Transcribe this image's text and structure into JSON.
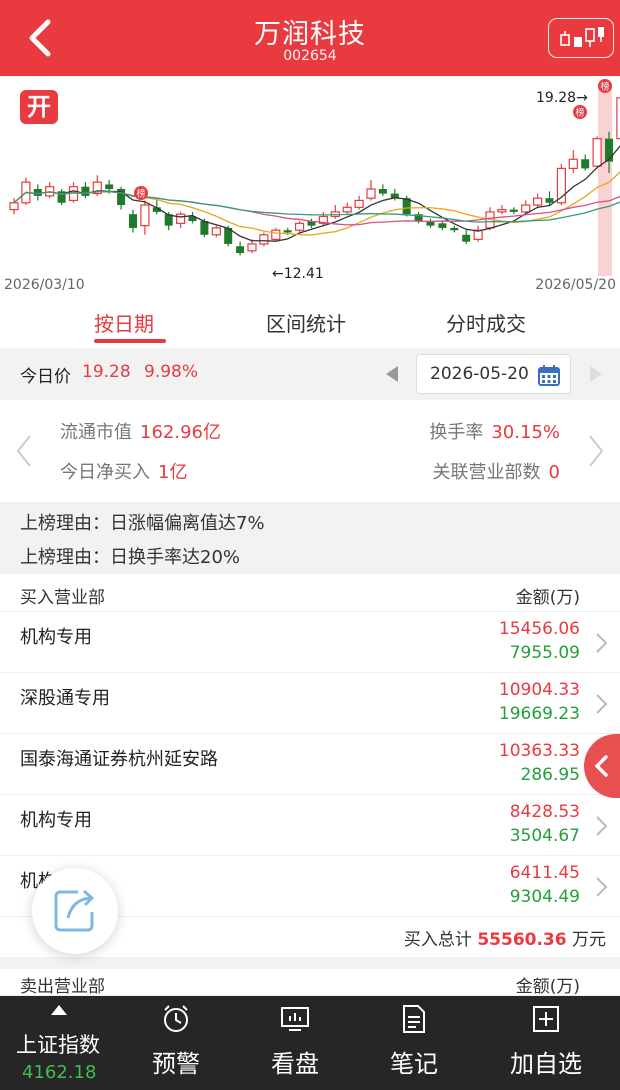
{
  "header": {
    "title": "万润科技",
    "code": "002654"
  },
  "chart": {
    "logo_text": "开",
    "start_date": "2026/03/10",
    "end_date": "2026/05/20",
    "high_label": "19.28",
    "low_label": "12.41",
    "badge_text": "榜"
  },
  "tabs": [
    {
      "label": "按日期",
      "active": true
    },
    {
      "label": "区间统计",
      "active": false
    },
    {
      "label": "分时成交",
      "active": false
    }
  ],
  "price_row": {
    "label": "今日价",
    "price": "19.28",
    "change_pct": "9.98%",
    "date": "2026-05-20"
  },
  "stats": {
    "float_cap_label": "流通市值",
    "float_cap_value": "162.96亿",
    "turnover_label": "换手率",
    "turnover_value": "30.15%",
    "net_buy_label": "今日净买入",
    "net_buy_value": "1亿",
    "branches_label": "关联营业部数",
    "branches_value": "0"
  },
  "reasons": [
    "上榜理由：日涨幅偏离值达7%",
    "上榜理由：日换手率达20%"
  ],
  "buy_table": {
    "header_left": "买入营业部",
    "header_right": "金额(万)",
    "rows": [
      {
        "name": "机构专用",
        "buy": "15456.06",
        "sell": "7955.09"
      },
      {
        "name": "深股通专用",
        "buy": "10904.33",
        "sell": "19669.23"
      },
      {
        "name": "国泰海通证券杭州延安路",
        "buy": "10363.33",
        "sell": "286.95"
      },
      {
        "name": "机构专用",
        "buy": "8428.53",
        "sell": "3504.67"
      },
      {
        "name": "机构专用",
        "buy": "6411.45",
        "sell": "9304.49"
      }
    ],
    "total_label": "买入总计",
    "total_value": "55560.36",
    "total_unit": "万元"
  },
  "sell_table": {
    "header_left": "卖出营业部",
    "header_right": "金额(万)"
  },
  "bottom_nav": {
    "index_name": "上证指数",
    "index_value": "4162.18",
    "items": [
      {
        "label": "预警",
        "icon": "alarm-clock-icon"
      },
      {
        "label": "看盘",
        "icon": "monitor-icon"
      },
      {
        "label": "笔记",
        "icon": "note-icon"
      },
      {
        "label": "加自选",
        "icon": "add-favorite-icon"
      }
    ]
  },
  "colors": {
    "brand_red": "#e83a3f",
    "up_red": "#e83a3f",
    "down_green": "#22a03a",
    "index_green": "#3fbf4f"
  }
}
